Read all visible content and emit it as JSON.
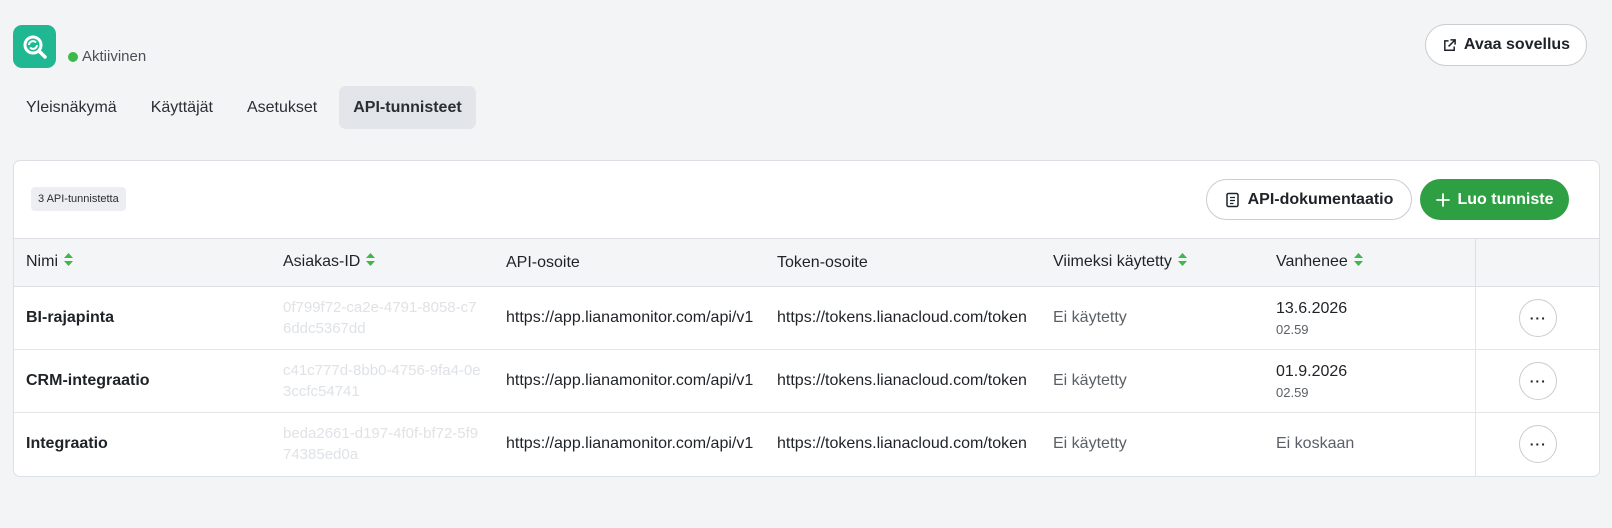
{
  "header": {
    "status": "Aktiivinen",
    "open_app_label": "Avaa sovellus"
  },
  "tabs": [
    {
      "label": "Yleisnäkymä",
      "active": false
    },
    {
      "label": "Käyttäjät",
      "active": false
    },
    {
      "label": "Asetukset",
      "active": false
    },
    {
      "label": "API-tunnisteet",
      "active": true
    }
  ],
  "card": {
    "count_label": "3 API-tunnistetta",
    "docs_label": "API-dokumentaatio",
    "create_label": "Luo tunniste"
  },
  "table": {
    "columns": [
      "Nimi",
      "Asiakas-ID",
      "API-osoite",
      "Token-osoite",
      "Viimeksi käytetty",
      "Vanhenee"
    ],
    "rows": [
      {
        "name": "BI-rajapinta",
        "client_id": "0f799f72-ca2e-4791-8058-c76ddc5367dd",
        "api_url": "https://app.lianamonitor.com/api/v1",
        "token_url": "https://tokens.lianacloud.com/token",
        "last_used": "Ei käytetty",
        "expires_date": "13.6.2026",
        "expires_time": "02.59"
      },
      {
        "name": "CRM-integraatio",
        "client_id": "c41c777d-8bb0-4756-9fa4-0e3ccfc54741",
        "api_url": "https://app.lianamonitor.com/api/v1",
        "token_url": "https://tokens.lianacloud.com/token",
        "last_used": "Ei käytetty",
        "expires_date": "01.9.2026",
        "expires_time": "02.59"
      },
      {
        "name": "Integraatio",
        "client_id": "beda2661-d197-4f0f-bf72-5f974385ed0a",
        "api_url": "https://app.lianamonitor.com/api/v1",
        "token_url": "https://tokens.lianacloud.com/token",
        "last_used": "Ei käytetty",
        "expires_date": "Ei koskaan",
        "expires_time": ""
      }
    ],
    "more_label": "···"
  },
  "colors": {
    "brand": "#1fb893",
    "status_active": "#3db94a",
    "primary_button": "#2ea043",
    "sort_arrow": "#3db94a"
  }
}
